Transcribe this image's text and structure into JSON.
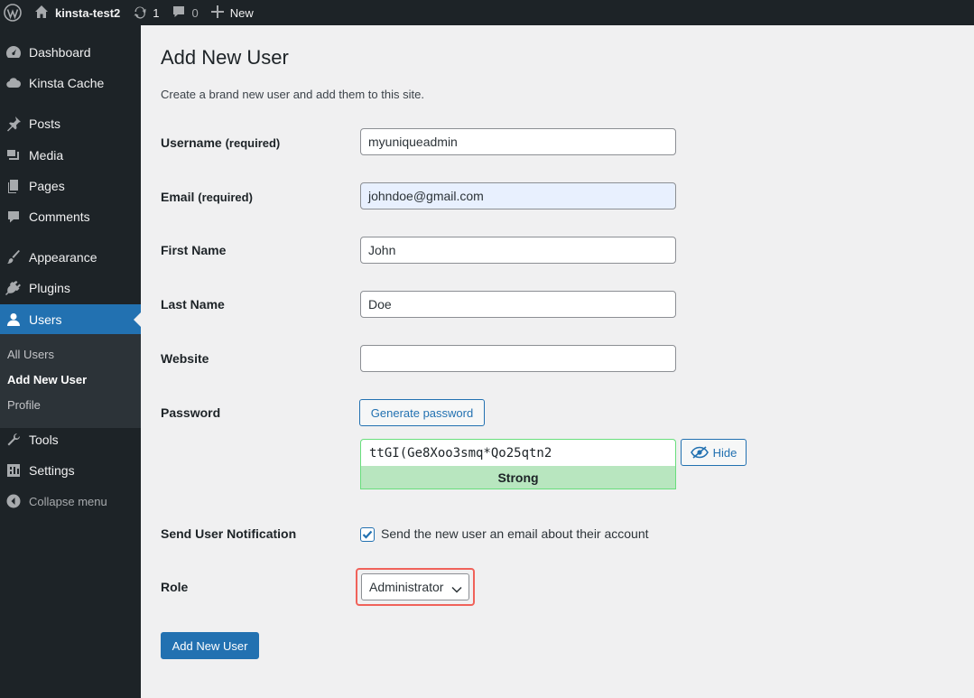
{
  "adminbar": {
    "site_name": "kinsta-test2",
    "updates_count": "1",
    "comments_count": "0",
    "new_label": "New"
  },
  "sidebar": {
    "items": [
      {
        "label": "Dashboard",
        "icon": "dashboard-icon"
      },
      {
        "label": "Kinsta Cache",
        "icon": "cloud-icon"
      },
      {
        "label": "Posts",
        "icon": "pin-icon"
      },
      {
        "label": "Media",
        "icon": "media-icon"
      },
      {
        "label": "Pages",
        "icon": "pages-icon"
      },
      {
        "label": "Comments",
        "icon": "comment-icon"
      },
      {
        "label": "Appearance",
        "icon": "brush-icon"
      },
      {
        "label": "Plugins",
        "icon": "plugin-icon"
      },
      {
        "label": "Users",
        "icon": "user-icon"
      },
      {
        "label": "Tools",
        "icon": "wrench-icon"
      },
      {
        "label": "Settings",
        "icon": "settings-icon"
      }
    ],
    "submenu": [
      "All Users",
      "Add New User",
      "Profile"
    ],
    "collapse_label": "Collapse menu"
  },
  "page": {
    "title": "Add New User",
    "description": "Create a brand new user and add them to this site."
  },
  "form": {
    "username_label": "Username",
    "username_req": "(required)",
    "username_value": "myuniqueadmin",
    "email_label": "Email",
    "email_req": "(required)",
    "email_value": "johndoe@gmail.com",
    "first_name_label": "First Name",
    "first_name_value": "John",
    "last_name_label": "Last Name",
    "last_name_value": "Doe",
    "website_label": "Website",
    "website_value": "",
    "password_label": "Password",
    "generate_password_label": "Generate password",
    "password_value": "ttGI(Ge8Xoo3smq*Qo25qtn2",
    "password_strength": "Strong",
    "hide_label": "Hide",
    "notification_label": "Send User Notification",
    "notification_checkbox_label": "Send the new user an email about their account",
    "notification_checked": true,
    "role_label": "Role",
    "role_value": "Administrator",
    "submit_label": "Add New User"
  },
  "colors": {
    "accent": "#2271b1",
    "adminbar_bg": "#1d2327",
    "strength_bg": "#b8e6bf",
    "highlight": "#f0625a"
  }
}
